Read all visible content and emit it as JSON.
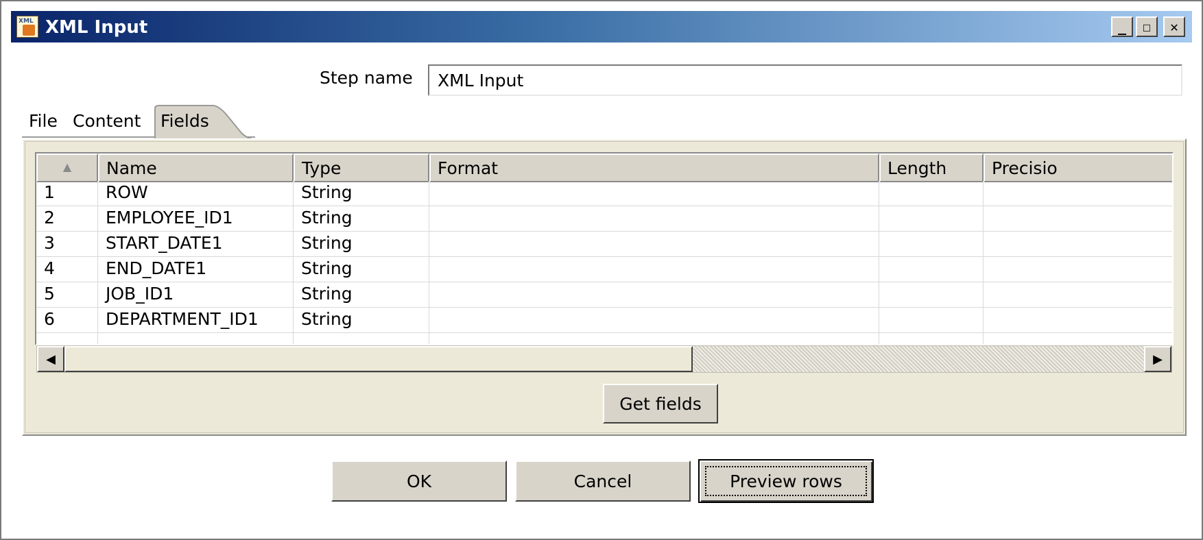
{
  "window": {
    "title": "XML Input",
    "icon": "xml-file-icon",
    "icon_glyph": "XML",
    "controls": {
      "minimize": "_",
      "maximize": "☐",
      "close": "✕"
    }
  },
  "step": {
    "label": "Step name",
    "value": "XML Input"
  },
  "tabs": [
    {
      "label": "File",
      "selected": false
    },
    {
      "label": "Content",
      "selected": false
    },
    {
      "label": "Fields",
      "selected": true
    }
  ],
  "table": {
    "sort_indicator": "▲",
    "columns": [
      "Name",
      "Type",
      "Format",
      "Length",
      "Precisio"
    ],
    "rows": [
      {
        "num": "1",
        "name": "ROW",
        "type": "String",
        "format": "",
        "length": "",
        "precision": ""
      },
      {
        "num": "2",
        "name": "EMPLOYEE_ID1",
        "type": "String",
        "format": "",
        "length": "",
        "precision": ""
      },
      {
        "num": "3",
        "name": "START_DATE1",
        "type": "String",
        "format": "",
        "length": "",
        "precision": ""
      },
      {
        "num": "4",
        "name": "END_DATE1",
        "type": "String",
        "format": "",
        "length": "",
        "precision": ""
      },
      {
        "num": "5",
        "name": "JOB_ID1",
        "type": "String",
        "format": "",
        "length": "",
        "precision": ""
      },
      {
        "num": "6",
        "name": "DEPARTMENT_ID1",
        "type": "String",
        "format": "",
        "length": "",
        "precision": ""
      }
    ]
  },
  "scrollbar": {
    "left_arrow": "◀",
    "right_arrow": "▶"
  },
  "buttons": {
    "get_fields": "Get fields",
    "ok": "OK",
    "cancel": "Cancel",
    "preview": "Preview rows"
  },
  "colors": {
    "title_start": "#0a246a",
    "title_end": "#a6caf0",
    "face": "#d8d4ca"
  }
}
